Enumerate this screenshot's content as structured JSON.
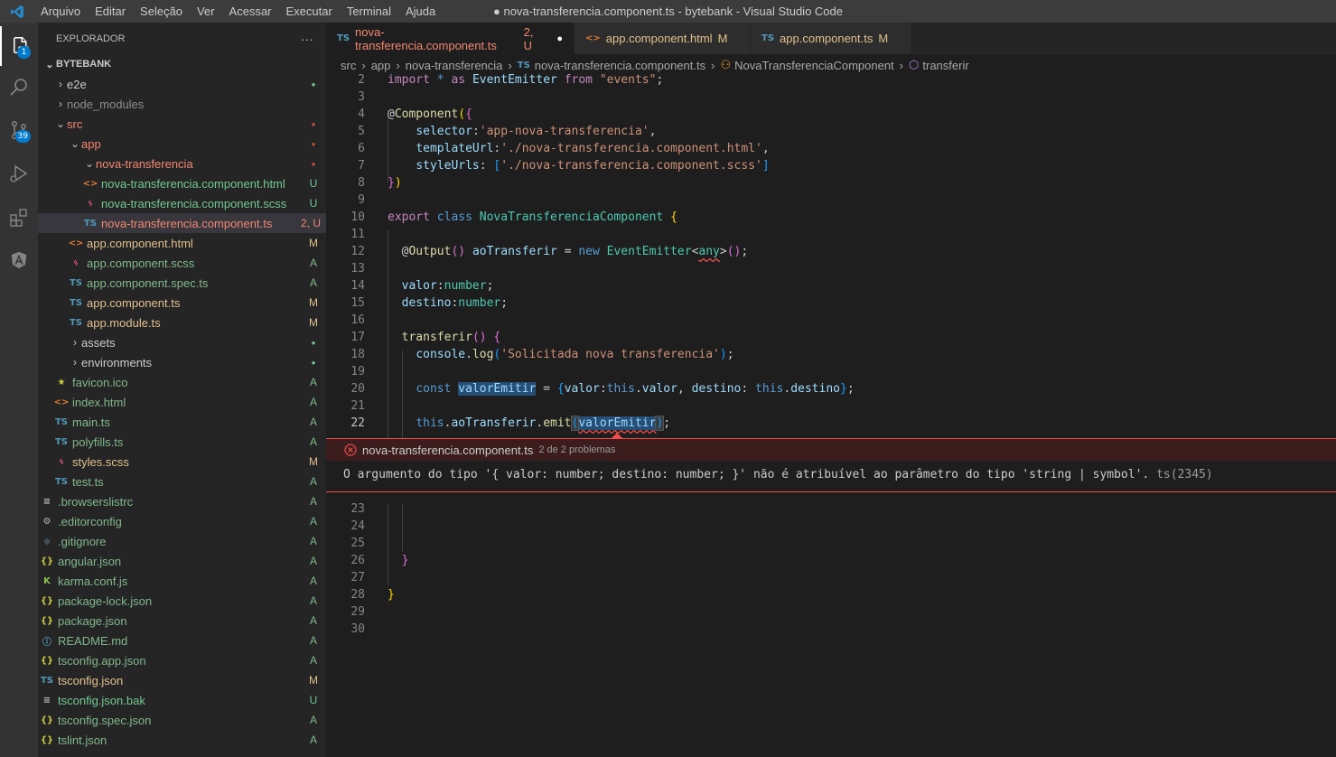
{
  "titlebar": {
    "menu": [
      "Arquivo",
      "Editar",
      "Seleção",
      "Ver",
      "Acessar",
      "Executar",
      "Terminal",
      "Ajuda"
    ],
    "title": "● nova-transferencia.component.ts - bytebank - Visual Studio Code"
  },
  "activity": {
    "scm_badge": "39",
    "explorer_badge": "1"
  },
  "sidebar": {
    "header": "EXPLORADOR",
    "more": "···",
    "section": "BYTEBANK",
    "items": [
      {
        "label": "e2e",
        "deco": "●"
      },
      {
        "label": "node_modules",
        "deco": ""
      },
      {
        "label": "src",
        "deco": "●"
      },
      {
        "label": "app",
        "deco": "●"
      },
      {
        "label": "nova-transferencia",
        "deco": "●"
      },
      {
        "label": "nova-transferencia.component.html",
        "deco": "U"
      },
      {
        "label": "nova-transferencia.component.scss",
        "deco": "U"
      },
      {
        "label": "nova-transferencia.component.ts",
        "deco": "2, U"
      },
      {
        "label": "app.component.html",
        "deco": "M"
      },
      {
        "label": "app.component.scss",
        "deco": "A"
      },
      {
        "label": "app.component.spec.ts",
        "deco": "A"
      },
      {
        "label": "app.component.ts",
        "deco": "M"
      },
      {
        "label": "app.module.ts",
        "deco": "M"
      },
      {
        "label": "assets",
        "deco": "●"
      },
      {
        "label": "environments",
        "deco": "●"
      },
      {
        "label": "favicon.ico",
        "deco": "A"
      },
      {
        "label": "index.html",
        "deco": "A"
      },
      {
        "label": "main.ts",
        "deco": "A"
      },
      {
        "label": "polyfills.ts",
        "deco": "A"
      },
      {
        "label": "styles.scss",
        "deco": "M"
      },
      {
        "label": "test.ts",
        "deco": "A"
      },
      {
        "label": ".browserslistrc",
        "deco": "A"
      },
      {
        "label": ".editorconfig",
        "deco": "A"
      },
      {
        "label": ".gitignore",
        "deco": "A"
      },
      {
        "label": "angular.json",
        "deco": "A"
      },
      {
        "label": "karma.conf.js",
        "deco": "A"
      },
      {
        "label": "package-lock.json",
        "deco": "A"
      },
      {
        "label": "package.json",
        "deco": "A"
      },
      {
        "label": "README.md",
        "deco": "A"
      },
      {
        "label": "tsconfig.app.json",
        "deco": "A"
      },
      {
        "label": "tsconfig.json",
        "deco": "M"
      },
      {
        "label": "tsconfig.json.bak",
        "deco": "U"
      },
      {
        "label": "tsconfig.spec.json",
        "deco": "A"
      },
      {
        "label": "tslint.json",
        "deco": "A"
      }
    ]
  },
  "tabs": [
    {
      "icon": "TS",
      "label": "nova-transferencia.component.ts",
      "status": "2, U",
      "dirty": "●"
    },
    {
      "icon": "<>",
      "label": "app.component.html",
      "status": "M"
    },
    {
      "icon": "TS",
      "label": "app.component.ts",
      "status": "M"
    }
  ],
  "breadcrumb": [
    "src",
    "app",
    "nova-transferencia",
    "nova-transferencia.component.ts",
    "NovaTransferenciaComponent",
    "transferir"
  ],
  "editor": {
    "line_numbers_top": [
      "2",
      "3",
      "4",
      "5",
      "6",
      "7",
      "8",
      "9",
      "10",
      "11",
      "12",
      "13",
      "14",
      "15",
      "16",
      "17",
      "18",
      "19",
      "20",
      "21",
      "22"
    ],
    "line_numbers_bottom": [
      "23",
      "24",
      "25",
      "26",
      "27",
      "28",
      "29",
      "30"
    ],
    "tokens": {
      "import": "import",
      "star": "*",
      "as": "as",
      "EventEmitter": "EventEmitter",
      "from": "from",
      "events": "\"events\"",
      "Component": "Component",
      "selector": "selector",
      "selector_val": "'app-nova-transferencia'",
      "templateUrl": "templateUrl",
      "templateUrl_val": "'./nova-transferencia.component.html'",
      "styleUrls": "styleUrls",
      "styleUrls_val": "'./nova-transferencia.component.scss'",
      "export": "export",
      "class": "class",
      "className": "NovaTransferenciaComponent",
      "Output": "Output",
      "aoTransferir": "aoTransferir",
      "new": "new",
      "any": "any",
      "valor": "valor",
      "number": "number",
      "destino": "destino",
      "transferir": "transferir",
      "console": "console",
      "log": "log",
      "log_msg": "'Solicitada nova transferencia'",
      "const": "const",
      "valorEmitir": "valorEmitir",
      "this": "this",
      "emit": "emit"
    }
  },
  "problem": {
    "file": "nova-transferencia.component.ts",
    "count": "2 de 2 problemas",
    "message": "O argumento do tipo '{ valor: number; destino: number; }' não é atribuível ao parâmetro do tipo 'string | symbol'.",
    "code": "ts(2345)"
  },
  "colors": {
    "accent": "#007acc",
    "error": "#f14c4c",
    "untracked": "#73c991",
    "modified": "#e2c08d",
    "added": "#81b88b"
  }
}
